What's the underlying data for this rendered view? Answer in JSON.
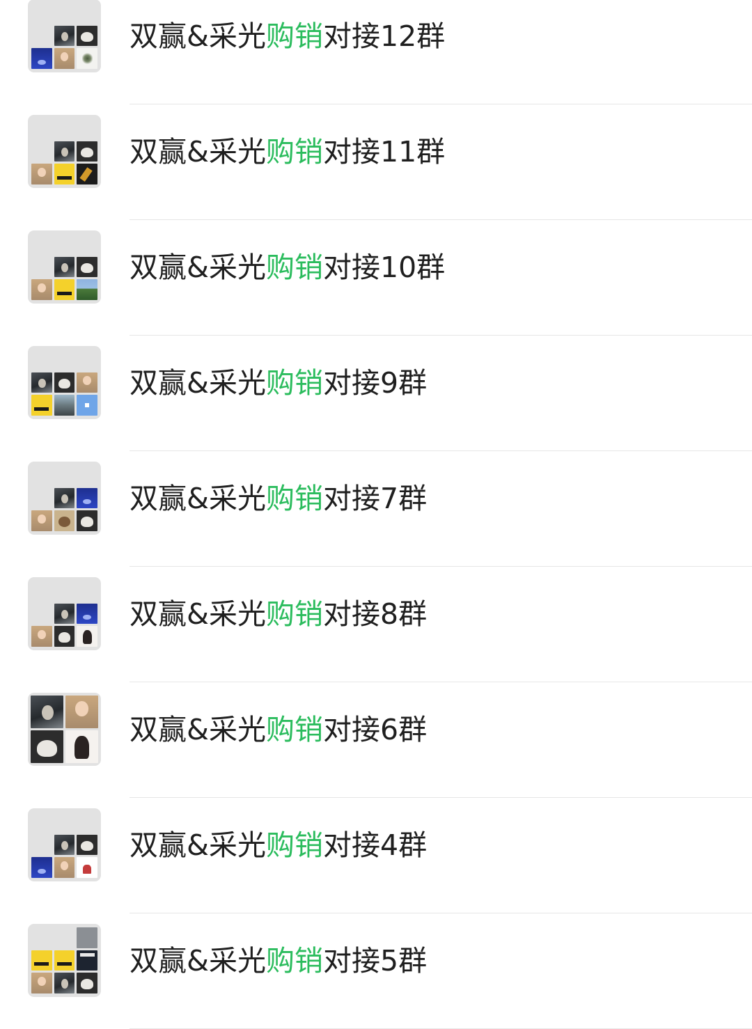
{
  "chat_list": {
    "items": [
      {
        "prefix": "双赢&采光",
        "highlight": "购销",
        "suffix": "对接12群",
        "avatar_tiles": [
          "empty",
          "t-dark",
          "t-moon",
          "t-blue",
          "t-girl",
          "t-ink"
        ],
        "layout": "grid3"
      },
      {
        "prefix": "双赢&采光",
        "highlight": "购销",
        "suffix": "对接11群",
        "avatar_tiles": [
          "empty",
          "t-dark",
          "t-moon",
          "t-girl",
          "t-yellow",
          "t-bottle"
        ],
        "layout": "grid3"
      },
      {
        "prefix": "双赢&采光",
        "highlight": "购销",
        "suffix": "对接10群",
        "avatar_tiles": [
          "empty",
          "t-dark",
          "t-moon",
          "t-girl",
          "t-yellow",
          "t-land"
        ],
        "layout": "grid3"
      },
      {
        "prefix": "双赢&采光",
        "highlight": "购销",
        "suffix": "对接9群",
        "avatar_tiles": [
          "t-dark",
          "t-moon",
          "t-girl",
          "t-yellow",
          "t-street",
          "t-sky"
        ],
        "layout": "grid3"
      },
      {
        "prefix": "双赢&采光",
        "highlight": "购销",
        "suffix": "对接7群",
        "avatar_tiles": [
          "empty",
          "t-dark",
          "t-blue",
          "t-girl",
          "t-teapot",
          "t-moon"
        ],
        "layout": "grid3"
      },
      {
        "prefix": "双赢&采光",
        "highlight": "购销",
        "suffix": "对接8群",
        "avatar_tiles": [
          "empty",
          "t-dark",
          "t-blue",
          "t-girl",
          "t-moon",
          "t-portrait"
        ],
        "layout": "grid3"
      },
      {
        "prefix": "双赢&采光",
        "highlight": "购销",
        "suffix": "对接6群",
        "avatar_tiles": [
          "t-dark",
          "t-girl",
          "t-moon",
          "t-portrait"
        ],
        "layout": "grid2"
      },
      {
        "prefix": "双赢&采光",
        "highlight": "购销",
        "suffix": "对接4群",
        "avatar_tiles": [
          "empty",
          "t-dark",
          "t-moon",
          "t-blue",
          "t-girl",
          "t-red"
        ],
        "layout": "grid3"
      },
      {
        "prefix": "双赢&采光",
        "highlight": "购销",
        "suffix": "对接5群",
        "avatar_tiles": [
          "t-gray",
          "t-yellow",
          "t-yellow",
          "t-mag",
          "t-girl",
          "t-dark",
          "t-moon"
        ],
        "layout": "grid3"
      }
    ]
  }
}
